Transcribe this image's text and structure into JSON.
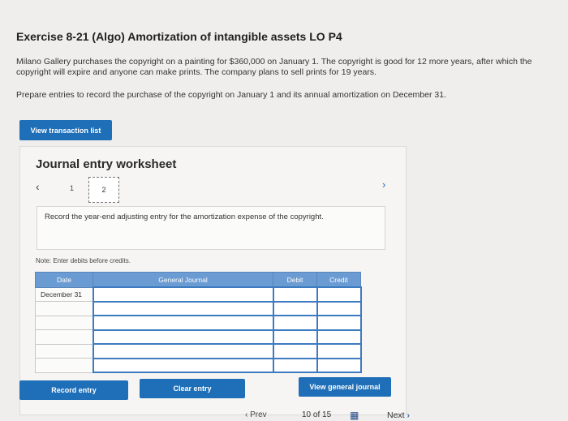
{
  "exercise": {
    "title": "Exercise 8-21 (Algo) Amortization of intangible assets LO P4",
    "paragraph1": "Milano Gallery purchases the copyright on a painting for $360,000 on January 1. The copyright is good for 12 more years, after which the copyright will expire and anyone can make prints. The company plans to sell prints for 19 years.",
    "paragraph2": "Prepare entries to record the purchase of the copyright on January 1 and its annual amortization on December 31."
  },
  "buttons": {
    "view_transactions": "View transaction list",
    "record_entry": "Record entry",
    "clear_entry": "Clear entry",
    "view_general_journal": "View general journal"
  },
  "worksheet": {
    "title": "Journal entry worksheet",
    "pages": [
      "1",
      "2"
    ],
    "current_page": "2",
    "instruction": "Record the year-end adjusting entry for the amortization expense of the copyright.",
    "note": "Note: Enter debits before credits."
  },
  "journal": {
    "headers": {
      "date": "Date",
      "general_journal": "General Journal",
      "debit": "Debit",
      "credit": "Credit"
    },
    "rows": [
      {
        "date": "December 31",
        "account": "",
        "debit": "",
        "credit": ""
      },
      {
        "date": "",
        "account": "",
        "debit": "",
        "credit": ""
      },
      {
        "date": "",
        "account": "",
        "debit": "",
        "credit": ""
      },
      {
        "date": "",
        "account": "",
        "debit": "",
        "credit": ""
      },
      {
        "date": "",
        "account": "",
        "debit": "",
        "credit": ""
      },
      {
        "date": "",
        "account": "",
        "debit": "",
        "credit": ""
      }
    ]
  },
  "footer": {
    "prev_label": "Prev",
    "current": "10",
    "of_label": "of",
    "total": "15",
    "next_label": "Next"
  },
  "icons": {
    "left": "chevron-left-icon",
    "right": "chevron-right-icon",
    "grid": "grid-icon"
  },
  "colors": {
    "button_blue": "#1f6fb8",
    "table_header": "#6a9bd2",
    "input_border": "#3d7bc0"
  }
}
